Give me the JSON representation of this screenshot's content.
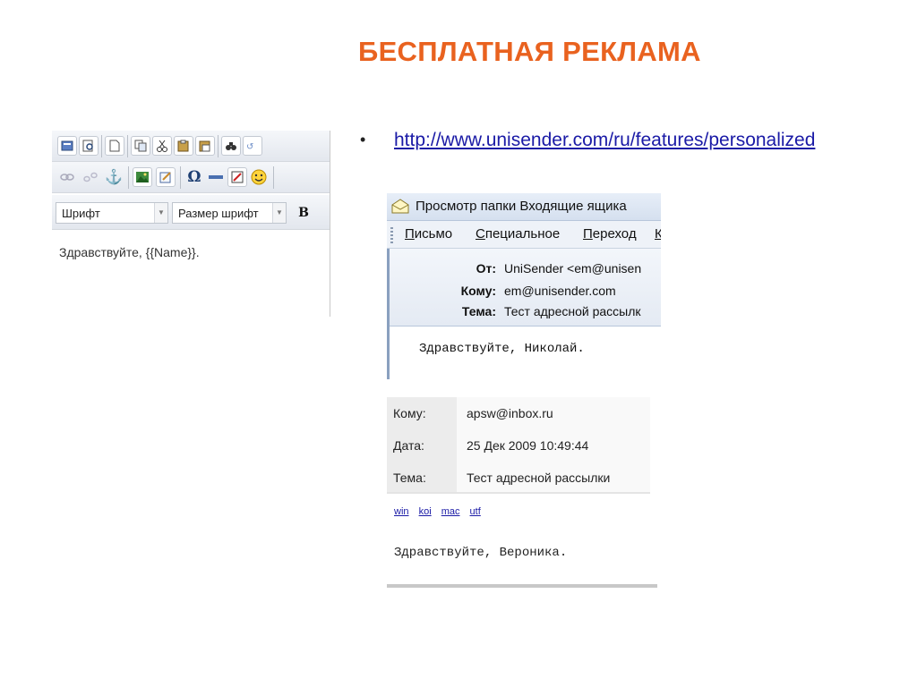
{
  "title": "БЕСПЛАТНАЯ РЕКЛАМА",
  "bullet_char": "•",
  "url": "http://www.unisender.com/ru/features/personalized",
  "editor": {
    "font_combo": "Шрифт",
    "size_combo": "Размер шрифт",
    "bold_label": "B",
    "omega_label": "Ω",
    "body_text": "Здравствуйте, {{Name}}."
  },
  "outlook": {
    "window_title": "Просмотр папки Входящие ящика",
    "menu": [
      {
        "label_u": "П",
        "label_rest": "исьмо"
      },
      {
        "label_u": "С",
        "label_rest": "пециальное"
      },
      {
        "label_u": "П",
        "label_rest": "ереход"
      },
      {
        "label_u": "К",
        "label_rest": ""
      }
    ],
    "from_label": "От:",
    "from_value": "UniSender <em@unisen",
    "to_label": "Кому:",
    "to_value": "em@unisender.com",
    "subject_label": "Тема:",
    "subject_value": "Тест адресной рассылк",
    "body": "Здравствуйте, Николай."
  },
  "webmail": {
    "to_label": "Кому:",
    "to_value": "apsw@inbox.ru",
    "date_label": "Дата:",
    "date_value": "25 Дек 2009 10:49:44",
    "subject_label": "Тема:",
    "subject_value": "Тест адресной рассылки",
    "encodings": [
      "win",
      "koi",
      "mac",
      "utf"
    ],
    "body": "Здравствуйте, Вероника."
  },
  "colors": {
    "title": "#e9621f",
    "link": "#1a1aa6"
  }
}
